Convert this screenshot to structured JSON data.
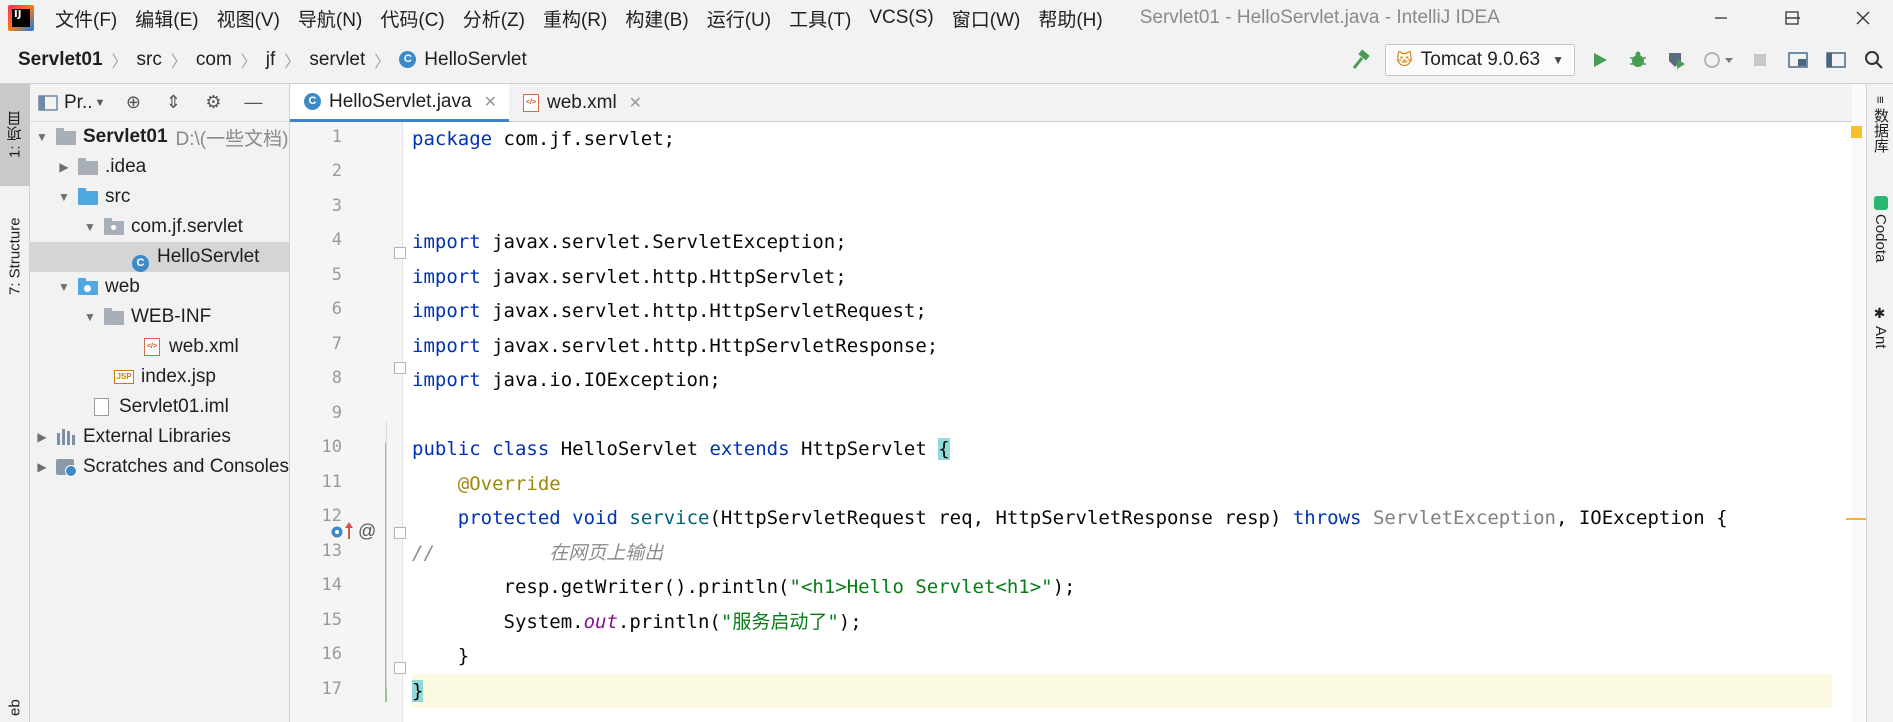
{
  "app": {
    "window_title": "Servlet01 - HelloServlet.java - IntelliJ IDEA",
    "logo_text": "IJ"
  },
  "menu": [
    "文件(F)",
    "编辑(E)",
    "视图(V)",
    "导航(N)",
    "代码(C)",
    "分析(Z)",
    "重构(R)",
    "构建(B)",
    "运行(U)",
    "工具(T)",
    "VCS(S)",
    "窗口(W)",
    "帮助(H)"
  ],
  "breadcrumb": [
    "Servlet01",
    "src",
    "com",
    "jf",
    "servlet",
    "HelloServlet"
  ],
  "toolbar": {
    "run_config": "Tomcat 9.0.63"
  },
  "left_strip": {
    "project_tab": "1: 项目",
    "structure_tab": "7: Structure",
    "web_tab": "eb"
  },
  "right_strip": {
    "database_tab": "数据库",
    "codota_tab": "Codota",
    "ant_tab": "Ant"
  },
  "project_panel": {
    "title": "Pr..",
    "tree": [
      {
        "label": "Servlet01",
        "path": "D:\\(一些文档)"
      },
      {
        "label": ".idea"
      },
      {
        "label": "src"
      },
      {
        "label": "com.jf.servlet"
      },
      {
        "label": "HelloServlet"
      },
      {
        "label": "web"
      },
      {
        "label": "WEB-INF"
      },
      {
        "label": "web.xml"
      },
      {
        "label": "index.jsp"
      },
      {
        "label": "Servlet01.iml"
      },
      {
        "label": "External Libraries"
      },
      {
        "label": "Scratches and Consoles"
      }
    ]
  },
  "editor": {
    "tabs": [
      "HelloServlet.java",
      "web.xml"
    ],
    "line_numbers": [
      "1",
      "2",
      "3",
      "4",
      "5",
      "6",
      "7",
      "8",
      "9",
      "10",
      "11",
      "12",
      "13",
      "14",
      "15",
      "16",
      "17"
    ],
    "code": {
      "l1_kw": "package",
      "l1_rest": " com.jf.servlet;",
      "import_kw": "import",
      "l4": " javax.servlet.ServletException;",
      "l5": " javax.servlet.http.HttpServlet;",
      "l6": " javax.servlet.http.HttpServletRequest;",
      "l7": " javax.servlet.http.HttpServletResponse;",
      "l8": " java.io.IOException;",
      "l10_public": "public",
      "l10_class": "class",
      "l10_name": " HelloServlet ",
      "l10_extends": "extends",
      "l10_super": " HttpServlet ",
      "l10_brace": "{",
      "l11_ann": "@Override",
      "l12_protected": "protected",
      "l12_void": "void",
      "l12_method": "service",
      "l12_params": "(HttpServletRequest req, HttpServletResponse resp) ",
      "l12_throws": "throws",
      "l12_ex1": " ServletException",
      "l12_ex2": ", IOException {",
      "l13_comment_slash": "//",
      "l13_comment_text": "在网页上输出",
      "l14_pre": "resp.getWriter().println(",
      "l14_str": "\"<h1>Hello Servlet<h1>\"",
      "l14_post": ");",
      "l15_pre": "System.",
      "l15_field": "out",
      "l15_mid": ".println(",
      "l15_str": "\"服务启动了\"",
      "l15_post": ");",
      "l16": "}",
      "l17": "}"
    }
  },
  "colors": {
    "keyword": "#0033b3",
    "annotation": "#9e880d",
    "string": "#067d17",
    "comment": "#8c8c8c",
    "method": "#00627a",
    "static_field": "#871094",
    "run_green": "#499c54"
  }
}
